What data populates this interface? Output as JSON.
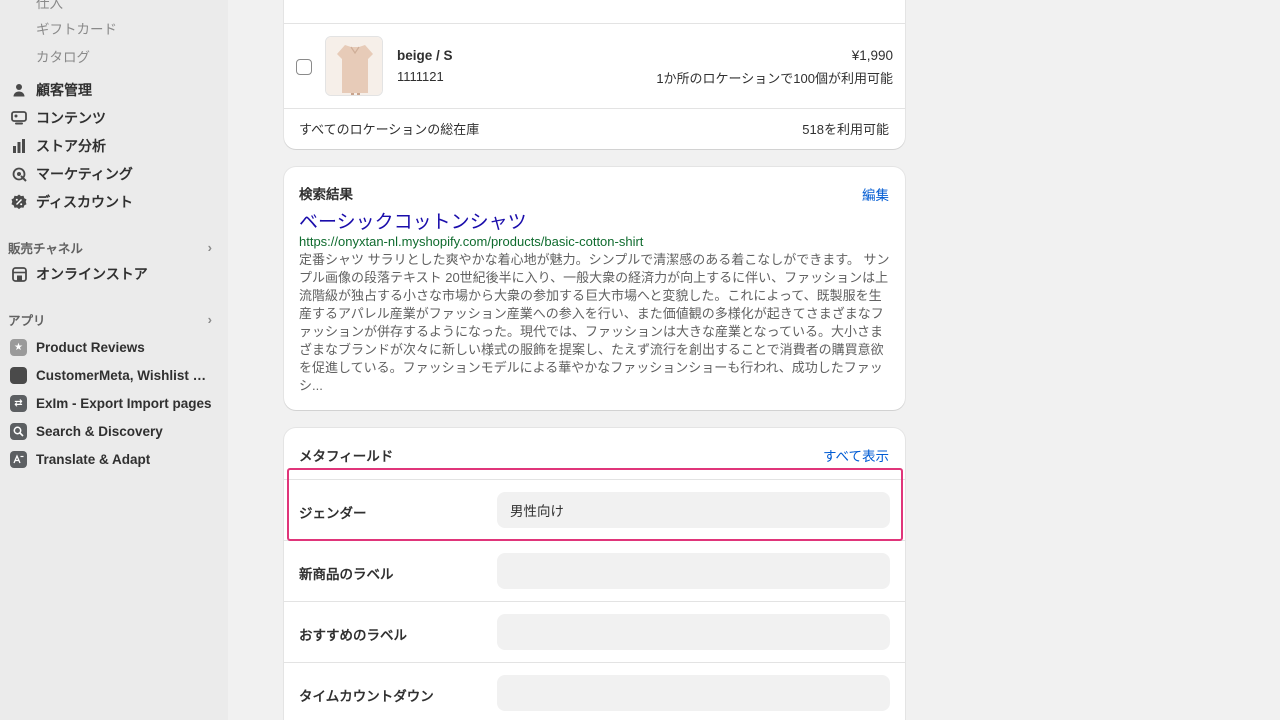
{
  "sidebar": {
    "sub_items": [
      "仕入",
      "ギフトカード",
      "カタログ"
    ],
    "items": [
      {
        "label": "顧客管理",
        "icon": "person-icon"
      },
      {
        "label": "コンテンツ",
        "icon": "content-icon"
      },
      {
        "label": "ストア分析",
        "icon": "bar-chart-icon"
      },
      {
        "label": "マーケティング",
        "icon": "target-icon"
      },
      {
        "label": "ディスカウント",
        "icon": "discount-icon"
      }
    ],
    "sales_channels": {
      "label": "販売チャネル",
      "items": [
        {
          "label": "オンラインストア",
          "icon": "store-icon"
        }
      ]
    },
    "apps": {
      "label": "アプリ",
      "items": [
        {
          "label": "Product Reviews",
          "icon": "star-icon"
        },
        {
          "label": "CustomerMeta, Wishlist C...",
          "icon": "app-icon"
        },
        {
          "label": "ExIm - Export Import pages",
          "icon": "exchange-icon"
        },
        {
          "label": "Search & Discovery",
          "icon": "search-icon"
        },
        {
          "label": "Translate & Adapt",
          "icon": "translate-icon"
        }
      ]
    }
  },
  "variants": {
    "row": {
      "name": "beige / S",
      "sku": "1111121",
      "price": "¥1,990",
      "availability": "1か所のロケーションで100個が利用可能"
    },
    "total_label": "すべてのロケーションの総在庫",
    "total_value": "518を利用可能"
  },
  "search_preview": {
    "heading": "検索結果",
    "edit_label": "編集",
    "title": "ベーシックコットンシャツ",
    "url": "https://onyxtan-nl.myshopify.com/products/basic-cotton-shirt",
    "description_lines": [
      "定番シャツ サラリとした爽やかな着心地が魅力。シンプルで清潔感のある着こなしができます。 サン",
      "プル画像の段落テキスト 20世紀後半に入り、一般大衆の経済力が向上するに伴い、ファッションは上",
      "流階級が独占する小さな市場から大衆の参加する巨大市場へと変貌した。これによって、既製服を生",
      "産するアパレル産業がファッション産業への参入を行い、また価値観の多様化が起きてさまざまなフ",
      "ァッションが併存するようになった。現代では、ファッションは大きな産業となっている。大小さま",
      "ざまなブランドが次々に新しい様式の服飾を提案し、たえず流行を創出することで消費者の購買意欲",
      "を促進している。ファッションモデルによる華やかなファッションショーも行われ、成功したファッ",
      "シ..."
    ]
  },
  "metafields": {
    "heading": "メタフィールド",
    "view_all_label": "すべて表示",
    "fields": [
      {
        "label": "ジェンダー",
        "value": "男性向け"
      },
      {
        "label": "新商品のラベル",
        "value": ""
      },
      {
        "label": "おすすめのラベル",
        "value": ""
      },
      {
        "label": "タイムカウントダウン",
        "value": ""
      }
    ]
  },
  "colors": {
    "accent_link": "#005bd3",
    "url_green": "#0f6b2e",
    "title_blue": "#1a0dab",
    "highlight": "#e0357a"
  }
}
